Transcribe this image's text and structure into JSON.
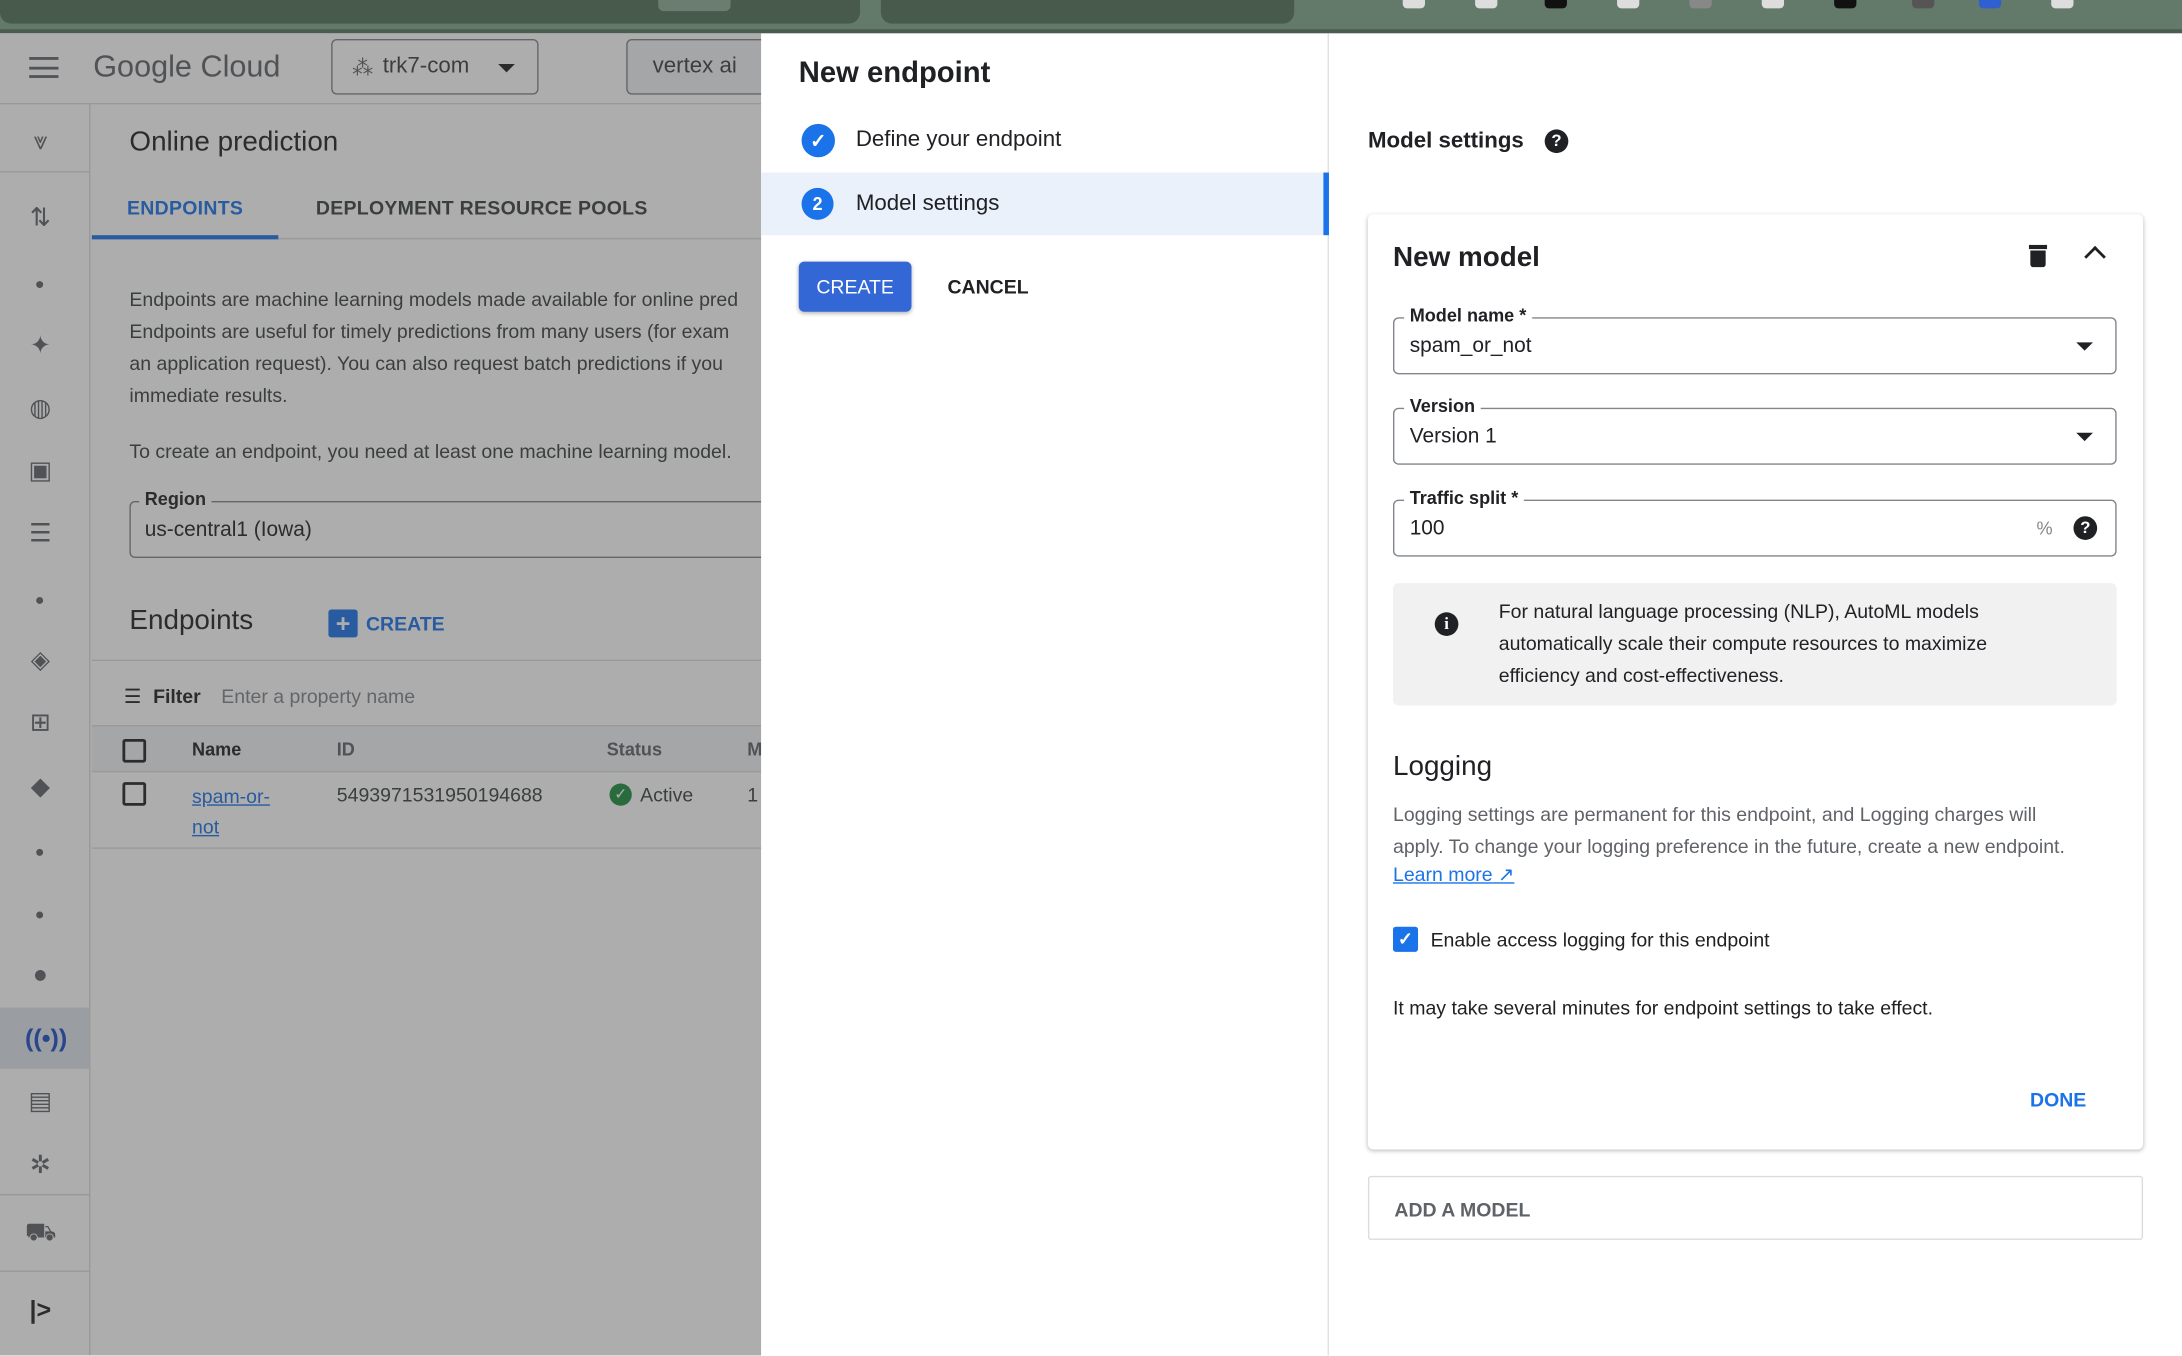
{
  "console": {
    "brand": "Google Cloud",
    "project": "trk7-com",
    "search_value": "vertex ai",
    "page_title": "Online prediction",
    "tabs": [
      "ENDPOINTS",
      "DEPLOYMENT RESOURCE POOLS"
    ],
    "active_tab": "ENDPOINTS",
    "description_lines": [
      "Endpoints are machine learning models made available for online pred",
      "Endpoints are useful for timely predictions from many users (for exam",
      "an application request). You can also request batch predictions if you",
      "immediate results."
    ],
    "create_hint": "To create an endpoint, you need at least one machine learning model.",
    "region_label": "Region",
    "region_value": "us-central1 (Iowa)",
    "endpoints_heading": "Endpoints",
    "create_label": "CREATE",
    "filter_label": "Filter",
    "filter_placeholder": "Enter a property name",
    "table": {
      "columns": [
        "Name",
        "ID",
        "Status",
        "M"
      ],
      "rows": [
        {
          "name_line1": "spam-or-",
          "name_line2": "not",
          "id": "5493971531950194688",
          "status": "Active",
          "m": "1"
        }
      ]
    },
    "rail_icons": [
      "vertex-ai-logo-icon",
      "pipelines-icon",
      "dot",
      "sparkle-icon",
      "globe-sparkle-icon",
      "image-sparkle-icon",
      "chat-sparkle-icon",
      "dot",
      "layers-icon",
      "dataset-icon",
      "label-icon",
      "dot",
      "dot",
      "lightbulb-icon",
      "online-prediction-icon",
      "batch-prediction-icon",
      "hub-icon",
      "marketplace-icon",
      "expand-rail-icon"
    ]
  },
  "drawer": {
    "title": "New endpoint",
    "steps": [
      {
        "label": "Define your endpoint",
        "state": "complete"
      },
      {
        "label": "Model settings",
        "state": "active",
        "number": "2"
      }
    ],
    "create_button": "CREATE",
    "cancel_button": "CANCEL"
  },
  "model_settings": {
    "heading": "Model settings",
    "card_title": "New model",
    "model_name_label": "Model name *",
    "model_name_value": "spam_or_not",
    "version_label": "Version",
    "version_value": "Version 1",
    "traffic_label": "Traffic split *",
    "traffic_value": "100",
    "traffic_unit": "%",
    "info_lines": [
      "For natural language processing (NLP), AutoML models",
      "automatically scale their compute resources to maximize",
      "efficiency and cost-effectiveness."
    ],
    "logging_heading": "Logging",
    "logging_lines": [
      "Logging settings are permanent for this endpoint, and Logging charges will",
      "apply. To change your logging preference in the future, create a new endpoint."
    ],
    "learn_more": "Learn more",
    "logging_checkbox_label": "Enable access logging for this endpoint",
    "logging_checked": true,
    "notice": "It may take several minutes for endpoint settings to take effect.",
    "done_button": "DONE",
    "add_model_button": "ADD A MODEL"
  },
  "colors": {
    "accent": "#1a73e8",
    "button": "#3367d6",
    "success": "#1e8e3e",
    "browser_bar": "#637a6a"
  }
}
